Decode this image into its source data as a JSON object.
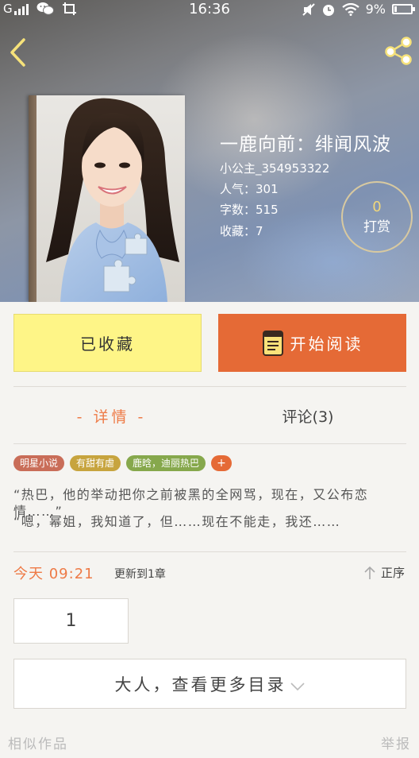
{
  "status_bar": {
    "carrier": "G",
    "time": "16:36",
    "battery": "9%"
  },
  "book": {
    "title": "一鹿向前：绯闻风波",
    "author": "小公主_354953322",
    "popularity_label": "人气：",
    "popularity": "301",
    "word_count_label": "字数：",
    "word_count": "515",
    "favorites_label": "收藏：",
    "favorites": "7"
  },
  "reward": {
    "count": "0",
    "label": "打赏"
  },
  "actions": {
    "collected_label": "已收藏",
    "read_label": "开始阅读"
  },
  "tabs": {
    "detail_label": "- 详情 -",
    "comment_label": "评论(3)"
  },
  "tags": [
    "明星小说",
    "有甜有虐",
    "鹿晗，迪丽热巴",
    "+"
  ],
  "intro": [
    "“热巴，他的举动把你之前被黑的全网骂，现在，又公布恋情……”",
    "“嗯，幂姐，我知道了，但……现在不能走，我还……"
  ],
  "update": {
    "time": "今天 09:21",
    "text": "更新到1章",
    "sort_label": "正序"
  },
  "page_number": "1",
  "more_catalog_label": "大人，查看更多目录",
  "footer": {
    "similar_label": "相似作品",
    "report_label": "举报"
  },
  "colors": {
    "accent": "#e56a36",
    "collected_bg": "#fef587",
    "tab_active": "#ee7a46"
  }
}
